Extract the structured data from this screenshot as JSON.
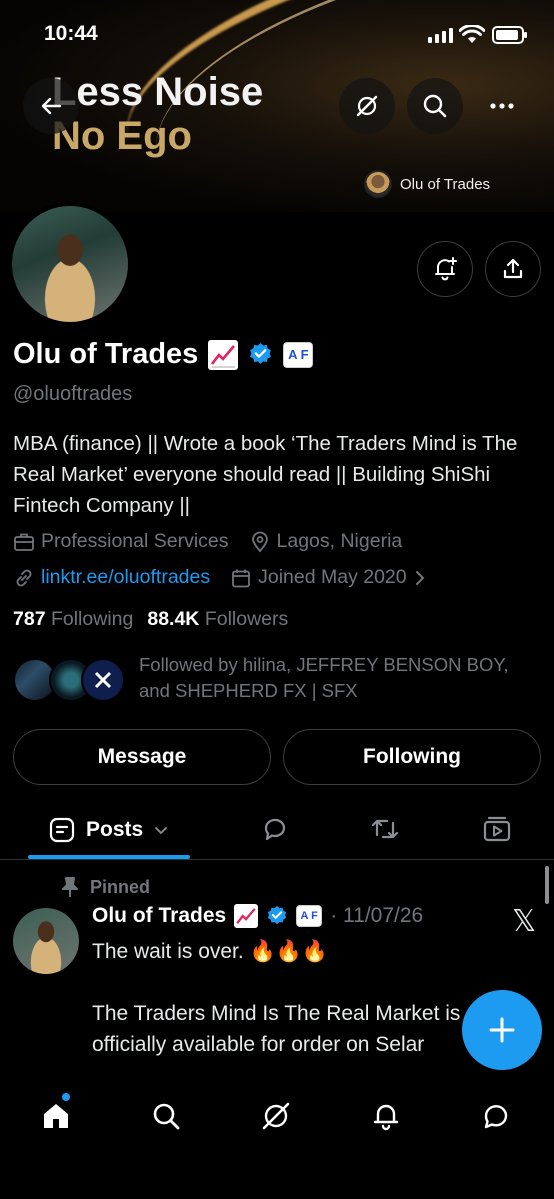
{
  "status_bar": {
    "time": "10:44"
  },
  "banner": {
    "line1": "Less Noise",
    "line2": "No Ego",
    "owner_name": "Olu of Trades"
  },
  "profile": {
    "name": "Olu of Trades",
    "affiliate_badge": "A F",
    "handle": "@oluoftrades",
    "bio": "MBA (finance) || Wrote a book ‘The Traders Mind is The Real Market’ everyone should read || Building ShiShi Fintech Company ||",
    "category": "Professional Services",
    "location": "Lagos, Nigeria",
    "link": "linktr.ee/oluoftrades",
    "joined": "Joined May 2020",
    "following_count": "787",
    "following_label": "Following",
    "followers_count": "88.4K",
    "followers_label": "Followers",
    "followed_by": "Followed by hilina, JEFFREY BENSON BOY, and SHEPHERD FX | SFX"
  },
  "actions": {
    "message": "Message",
    "following": "Following"
  },
  "tabs": {
    "posts": "Posts"
  },
  "post": {
    "pinned_label": "Pinned",
    "author": "Olu of Trades",
    "affiliate_badge": "A F",
    "date": "· 11/07/26",
    "line1": "The wait is over. 🔥🔥🔥",
    "line2": "The Traders Mind Is The Real Market is officially available for order on Selar"
  },
  "colors": {
    "accent": "#1d9bf0",
    "secondary_text": "#71767b",
    "banner_gold": "#c9a767"
  },
  "icons": [
    "back-arrow-icon",
    "grok-icon",
    "search-icon",
    "more-icon",
    "bell-plus-icon",
    "share-icon",
    "verified-icon",
    "briefcase-icon",
    "location-icon",
    "link-icon",
    "calendar-icon",
    "chevron-right-icon",
    "posts-icon",
    "reply-icon",
    "repost-icon",
    "media-icon",
    "pin-icon",
    "x-logo-icon",
    "plus-icon",
    "home-icon",
    "notifications-icon",
    "messages-icon"
  ]
}
